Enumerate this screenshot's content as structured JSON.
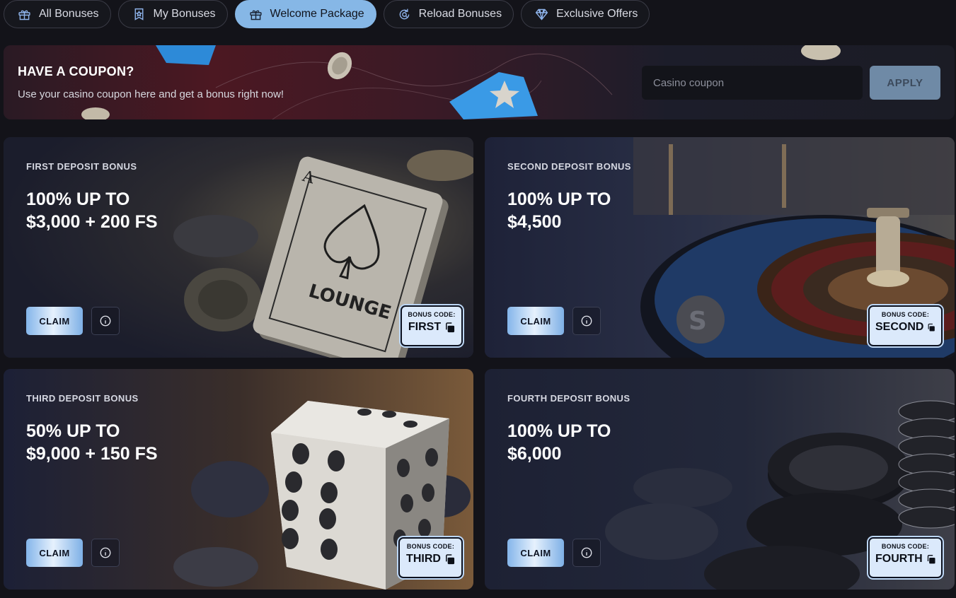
{
  "tabs": [
    {
      "label": "All Bonuses",
      "icon": "gift-icon"
    },
    {
      "label": "My Bonuses",
      "icon": "badge-icon"
    },
    {
      "label": "Welcome Package",
      "icon": "gift-icon",
      "active": true
    },
    {
      "label": "Reload Bonuses",
      "icon": "reload-icon"
    },
    {
      "label": "Exclusive Offers",
      "icon": "diamond-icon"
    }
  ],
  "coupon": {
    "title": "HAVE A COUPON?",
    "subtitle": "Use your casino coupon here and get a bonus right now!",
    "placeholder": "Casino coupon",
    "apply_label": "APPLY"
  },
  "bonuses": [
    {
      "label": "FIRST DEPOSIT BONUS",
      "title_line1": "100% UP TO",
      "title_line2": "$3,000 + 200 FS",
      "claim_label": "CLAIM",
      "code_label": "BONUS CODE:",
      "code": "FIRST",
      "art": "playing-cards"
    },
    {
      "label": "SECOND DEPOSIT BONUS",
      "title_line1": "100% UP TO",
      "title_line2": "$4,500",
      "claim_label": "CLAIM",
      "code_label": "BONUS CODE:",
      "code": "SECOND",
      "art": "roulette-wheel"
    },
    {
      "label": "THIRD DEPOSIT BONUS",
      "title_line1": "50% UP TO",
      "title_line2": "$9,000 + 150 FS",
      "claim_label": "CLAIM",
      "code_label": "BONUS CODE:",
      "code": "THIRD",
      "art": "dice"
    },
    {
      "label": "FOURTH DEPOSIT BONUS",
      "title_line1": "100% UP TO",
      "title_line2": "$6,000",
      "claim_label": "CLAIM",
      "code_label": "BONUS CODE:",
      "code": "FOURTH",
      "art": "poker-chips"
    }
  ],
  "colors": {
    "background": "#131319",
    "tab_active": "#86b7e6",
    "card_bg": "#1d2033",
    "claim_gradient": "#84b5ea",
    "code_bg": "#dbe9fb",
    "apply_bg": "#6f8aa6"
  }
}
